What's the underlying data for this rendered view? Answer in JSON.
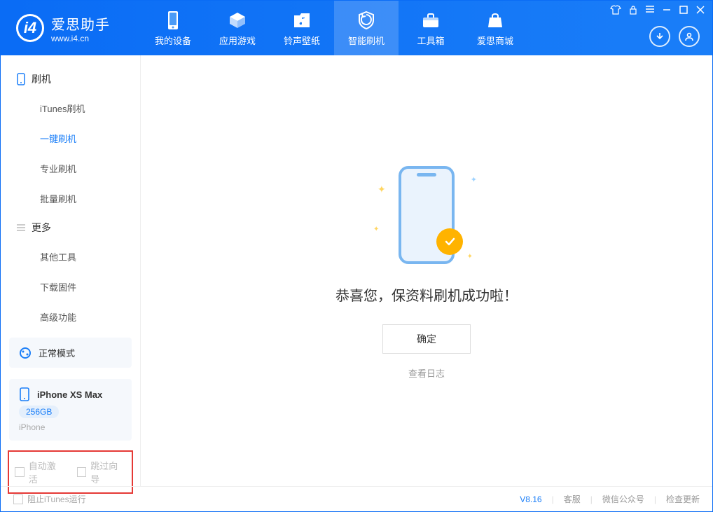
{
  "app": {
    "name": "爱思助手",
    "url": "www.i4.cn"
  },
  "nav": {
    "items": [
      {
        "label": "我的设备"
      },
      {
        "label": "应用游戏"
      },
      {
        "label": "铃声壁纸"
      },
      {
        "label": "智能刷机"
      },
      {
        "label": "工具箱"
      },
      {
        "label": "爱思商城"
      }
    ]
  },
  "sidebar": {
    "section1": {
      "title": "刷机",
      "items": [
        "iTunes刷机",
        "一键刷机",
        "专业刷机",
        "批量刷机"
      ]
    },
    "section2": {
      "title": "更多",
      "items": [
        "其他工具",
        "下载固件",
        "高级功能"
      ]
    }
  },
  "device": {
    "mode": "正常模式",
    "name": "iPhone XS Max",
    "storage": "256GB",
    "type": "iPhone"
  },
  "checks": {
    "c1": "自动激活",
    "c2": "跳过向导"
  },
  "main": {
    "success": "恭喜您，保资料刷机成功啦！",
    "ok": "确定",
    "viewlog": "查看日志"
  },
  "footer": {
    "block_itunes": "阻止iTunes运行",
    "version": "V8.16",
    "support": "客服",
    "wechat": "微信公众号",
    "update": "检查更新"
  }
}
